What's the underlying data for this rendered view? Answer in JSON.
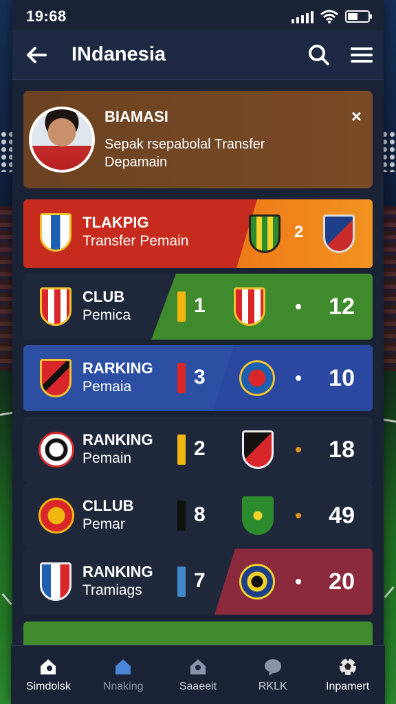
{
  "status": {
    "time": "19:68"
  },
  "header": {
    "title": "INdanesia"
  },
  "notification": {
    "title": "BIAMASI",
    "body": "Sepak rsepabolal Transfer Depamain",
    "close": "×"
  },
  "rows": [
    {
      "title": "TLAKPIG",
      "sub": "Transfer Pemain",
      "rank": "2",
      "score": ""
    },
    {
      "title": "CLUB",
      "sub": "Pemica",
      "rank": "1",
      "score": "12"
    },
    {
      "title": "RARKING",
      "sub": "Pemaia",
      "rank": "3",
      "score": "10"
    },
    {
      "title": "RANKING",
      "sub": "Pemain",
      "rank": "2",
      "score": "18"
    },
    {
      "title": "CLLUB",
      "sub": "Pemar",
      "rank": "8",
      "score": "49"
    },
    {
      "title": "RANKING",
      "sub": "Tramiags",
      "rank": "7",
      "score": "20"
    }
  ],
  "colors": {
    "accent_red": "#c72b1d",
    "accent_orange": "#f07f16",
    "accent_green": "#3f8a2c",
    "accent_blue": "#2c4fa3",
    "accent_maroon": "#8a2a3c",
    "indicator_yellow": "#f1b60f",
    "indicator_red": "#d8262b",
    "indicator_blue": "#4089c9",
    "dot_orange": "#e0931c"
  },
  "nav": {
    "items": [
      {
        "label": "Simdolsk",
        "icon": "home-icon"
      },
      {
        "label": "Nnaking",
        "icon": "house-icon"
      },
      {
        "label": "Saaeeit",
        "icon": "store-icon"
      },
      {
        "label": "RKLK",
        "icon": "chat-icon"
      },
      {
        "label": "Inpamert",
        "icon": "ball-icon"
      }
    ]
  }
}
